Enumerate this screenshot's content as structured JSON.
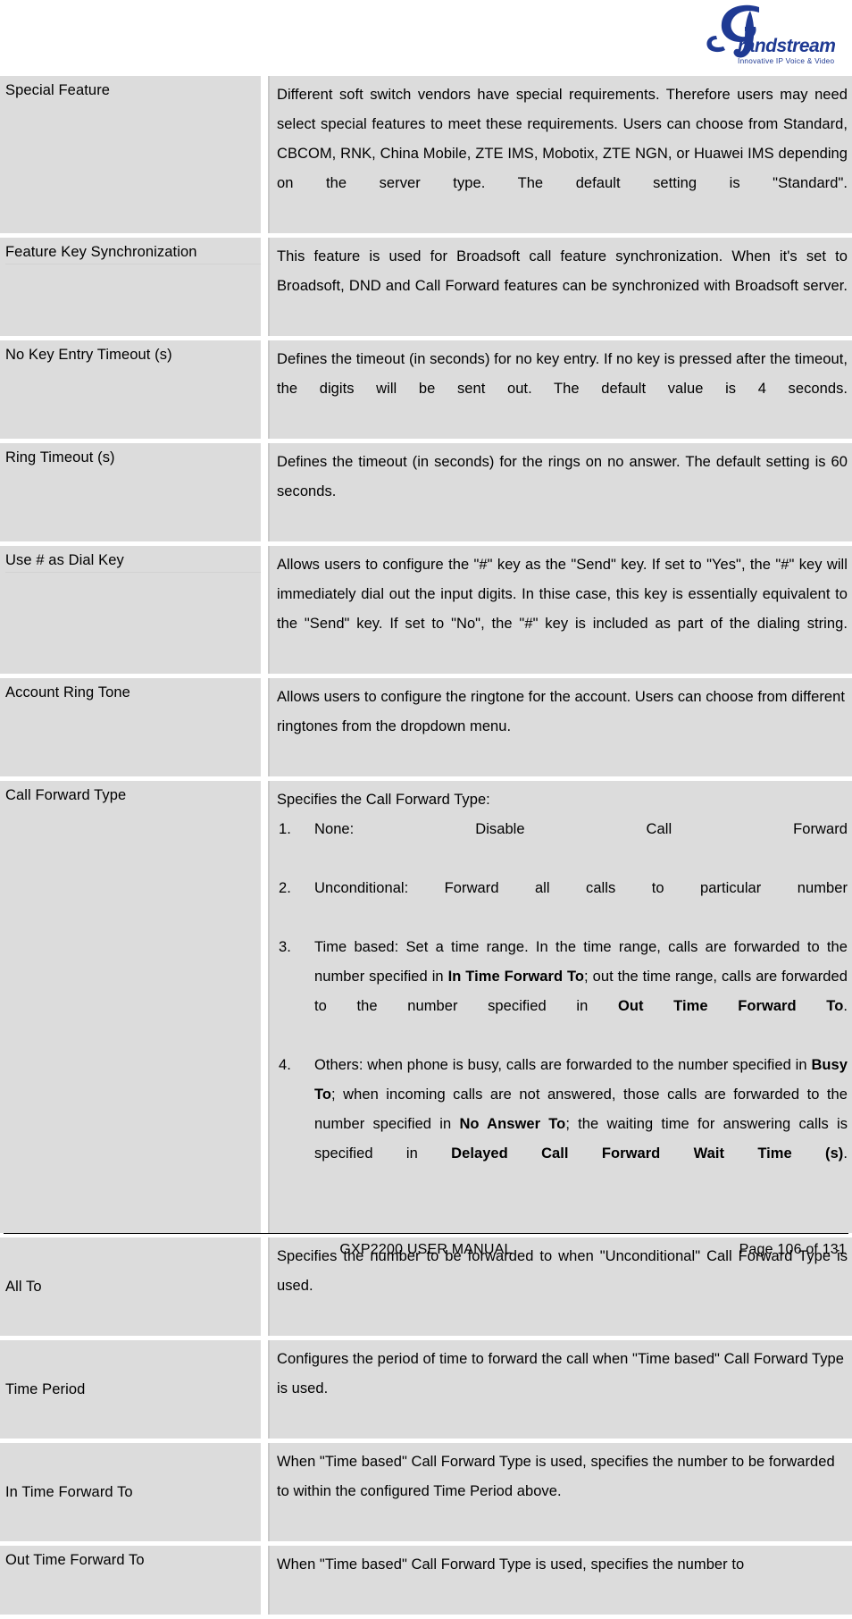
{
  "document": {
    "title": "GXP2200 USER MANUAL",
    "page_label": "Page 106 of 131"
  },
  "header": {
    "logo_name": "grandstream-logo",
    "logo_wordmark": "randstream",
    "logo_initial": "G",
    "logo_tagline": "Innovative IP Voice & Video",
    "logo_color": "#1f3a93"
  },
  "table": {
    "rows": [
      {
        "label": "Special Feature",
        "description": "Different soft switch vendors have special requirements. Therefore users may need select special features to meet these requirements. Users can choose from Standard, CBCOM, RNK, China Mobile, ZTE IMS, Mobotix, ZTE NGN, or Huawei IMS depending on the server type. The default setting is \"Standard\"."
      },
      {
        "label": "Feature Key Synchronization",
        "description": "This feature is used for Broadsoft call feature synchronization. When it's set to Broadsoft, DND and Call Forward features can be synchronized with Broadsoft server."
      },
      {
        "label": "No Key Entry Timeout (s)",
        "description": "Defines the timeout (in seconds) for no key entry. If no key is pressed after the timeout, the digits will be sent out. The default value is 4 seconds."
      },
      {
        "label": "Ring Timeout (s)",
        "description": "Defines the timeout (in seconds) for the rings on no answer. The default setting is 60 seconds."
      },
      {
        "label": "Use # as Dial Key",
        "description": "Allows users to configure the \"#\" key as the \"Send\" key. If set to \"Yes\", the \"#\" key will immediately dial out the input digits. In thise case, this key is essentially equivalent to the \"Send\" key. If set to \"No\", the \"#\" key is included as part of the dialing string."
      },
      {
        "label": "Account Ring Tone",
        "description": "Allows users to configure the ringtone for the account. Users can choose from different ringtones from the dropdown menu."
      },
      {
        "label": "Call Forward Type",
        "intro": "Specifies the Call Forward Type:",
        "items": [
          {
            "num": "1.",
            "parts": [
              {
                "t": "None: Disable Call Forward",
                "b": false
              }
            ]
          },
          {
            "num": "2.",
            "parts": [
              {
                "t": "Unconditional: Forward all calls to particular number",
                "b": false
              }
            ]
          },
          {
            "num": "3.",
            "parts": [
              {
                "t": "Time based: Set a time range. In the time range, calls are forwarded to the number specified in ",
                "b": false
              },
              {
                "t": "In Time Forward To",
                "b": true
              },
              {
                "t": "; out the time range, calls are forwarded to the number specified in ",
                "b": false
              },
              {
                "t": "Out Time Forward To",
                "b": true
              },
              {
                "t": ".",
                "b": false
              }
            ]
          },
          {
            "num": "4.",
            "parts": [
              {
                "t": "Others: when phone is busy, calls are forwarded to the number specified in ",
                "b": false
              },
              {
                "t": "Busy To",
                "b": true
              },
              {
                "t": "; when incoming calls are not answered, those calls are forwarded to the number specified in ",
                "b": false
              },
              {
                "t": "No Answer To",
                "b": true
              },
              {
                "t": "; the waiting time for answering calls is specified in ",
                "b": false
              },
              {
                "t": "Delayed Call Forward Wait Time (s)",
                "b": true
              },
              {
                "t": ".",
                "b": false
              }
            ]
          }
        ]
      },
      {
        "label": "All To",
        "description": "Specifies the number to be forwarded to when \"Unconditional\" Call Forward Type is used."
      },
      {
        "label": "Time Period",
        "description": "Configures the period of time to forward the call when \"Time based\" Call Forward Type is used."
      },
      {
        "label": "In Time Forward To",
        "description": "When \"Time based\" Call Forward Type is used, specifies the number to be forwarded to within the configured Time Period above."
      },
      {
        "label": "Out Time Forward To",
        "description": "When \"Time based\" Call Forward Type is used, specifies the number to"
      }
    ]
  }
}
